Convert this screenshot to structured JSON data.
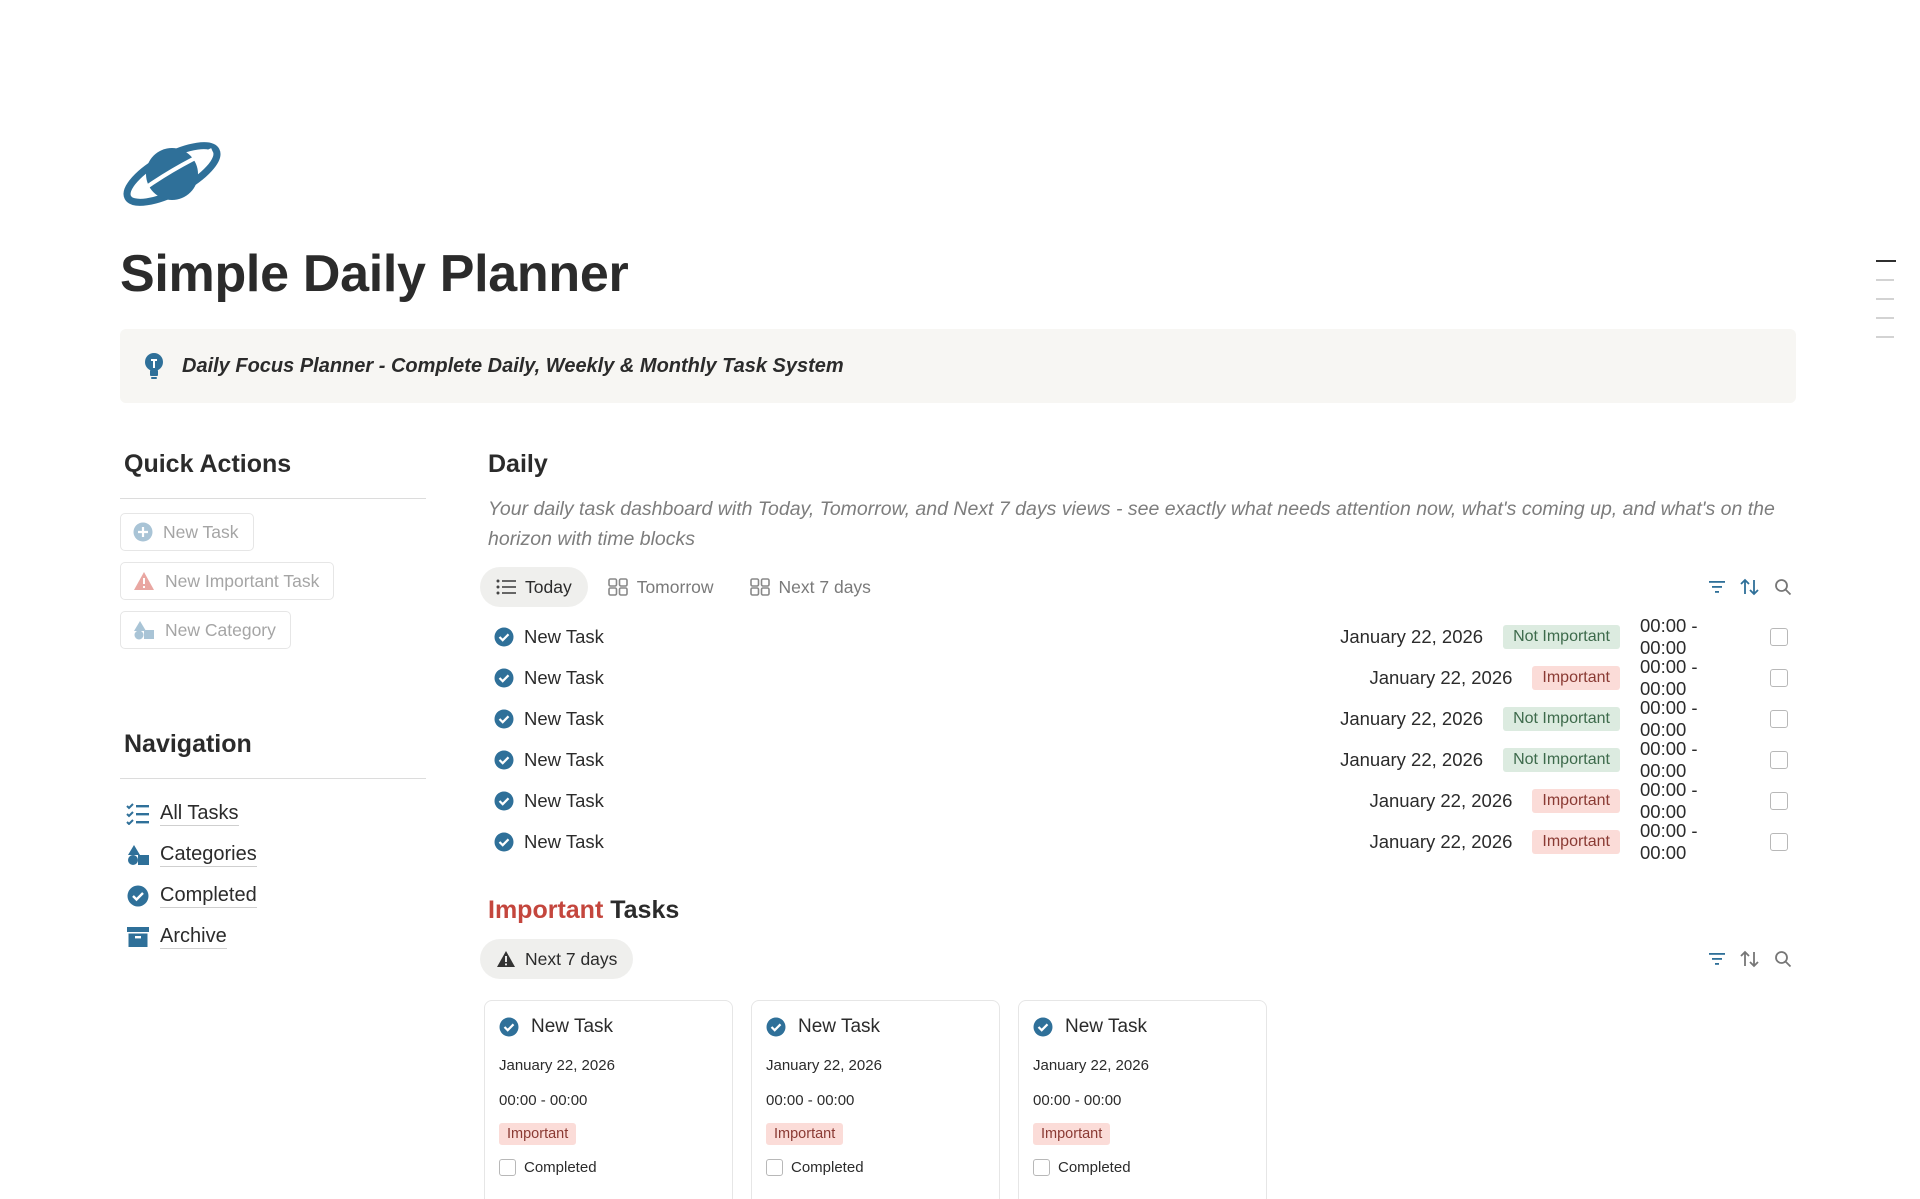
{
  "page": {
    "title": "Simple Daily Planner",
    "icon": "planet-icon",
    "callout": "Daily Focus Planner - Complete Daily, Weekly & Monthly Task System"
  },
  "quick_actions": {
    "heading": "Quick Actions",
    "buttons": [
      {
        "label": "New Task",
        "icon": "plus-circle-icon"
      },
      {
        "label": "New Important Task",
        "icon": "warning-icon"
      },
      {
        "label": "New Category",
        "icon": "shapes-icon"
      }
    ]
  },
  "navigation": {
    "heading": "Navigation",
    "items": [
      {
        "label": "All Tasks",
        "icon": "checklist-icon"
      },
      {
        "label": "Categories",
        "icon": "shapes-icon"
      },
      {
        "label": "Completed",
        "icon": "check-circle-icon"
      },
      {
        "label": "Archive",
        "icon": "archive-icon"
      }
    ]
  },
  "daily": {
    "title": "Daily",
    "description": "Your daily task dashboard with Today, Tomorrow, and Next 7 days views - see exactly what needs attention now, what's coming up, and what's on the horizon with time blocks",
    "tabs": [
      {
        "label": "Today",
        "icon": "list-icon",
        "active": true
      },
      {
        "label": "Tomorrow",
        "icon": "gallery-icon",
        "active": false
      },
      {
        "label": "Next 7 days",
        "icon": "gallery-icon",
        "active": false
      }
    ],
    "tasks": [
      {
        "name": "New Task",
        "date": "January 22, 2026",
        "priority": "Not Important",
        "time": "00:00 - 00:00"
      },
      {
        "name": "New Task",
        "date": "January 22, 2026",
        "priority": "Important",
        "time": "00:00 - 00:00"
      },
      {
        "name": "New Task",
        "date": "January 22, 2026",
        "priority": "Not Important",
        "time": "00:00 - 00:00"
      },
      {
        "name": "New Task",
        "date": "January 22, 2026",
        "priority": "Not Important",
        "time": "00:00 - 00:00"
      },
      {
        "name": "New Task",
        "date": "January 22, 2026",
        "priority": "Important",
        "time": "00:00 - 00:00"
      },
      {
        "name": "New Task",
        "date": "January 22, 2026",
        "priority": "Important",
        "time": "00:00 - 00:00"
      }
    ]
  },
  "important": {
    "title_accent": "Important",
    "title_rest": " Tasks",
    "tab": "Next 7 days",
    "cards": [
      {
        "name": "New Task",
        "date": "January 22, 2026",
        "time": "00:00 - 00:00",
        "priority": "Important",
        "checkbox_label": "Completed"
      },
      {
        "name": "New Task",
        "date": "January 22, 2026",
        "time": "00:00 - 00:00",
        "priority": "Important",
        "checkbox_label": "Completed"
      },
      {
        "name": "New Task",
        "date": "January 22, 2026",
        "time": "00:00 - 00:00",
        "priority": "Important",
        "checkbox_label": "Completed"
      }
    ]
  },
  "colors": {
    "accent_blue": "#2f7099",
    "important_red": "#c4463d",
    "tag_green_bg": "#dcebe0",
    "tag_red_bg": "#fbdcd8"
  }
}
